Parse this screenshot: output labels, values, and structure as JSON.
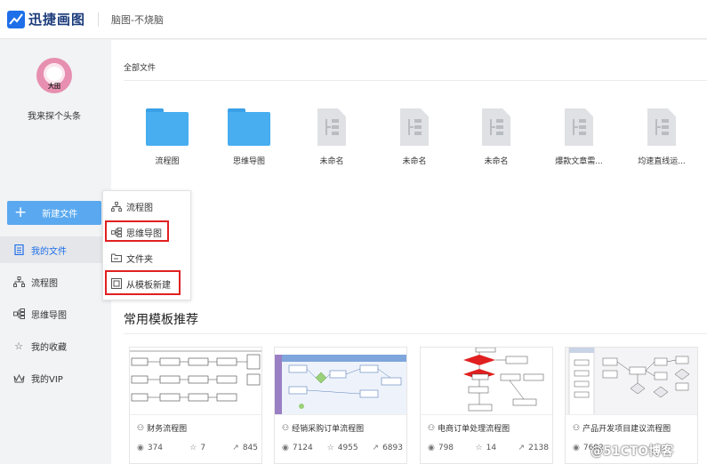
{
  "app": {
    "title": "迅捷画图",
    "document": "脑图-不烧脑"
  },
  "user": {
    "name": "我来探个头条",
    "avatar_tag": "大田"
  },
  "sidebar": {
    "new_button": "新建文件",
    "items": [
      {
        "label": "我的文件",
        "icon": "file-icon",
        "active": true
      },
      {
        "label": "流程图",
        "icon": "flowchart-icon"
      },
      {
        "label": "思维导图",
        "icon": "mindmap-icon"
      },
      {
        "label": "我的收藏",
        "icon": "star-icon"
      },
      {
        "label": "我的VIP",
        "icon": "crown-icon"
      }
    ]
  },
  "files": {
    "section_title": "全部文件",
    "items": [
      {
        "name": "流程图",
        "type": "folder"
      },
      {
        "name": "思维导图",
        "type": "folder"
      },
      {
        "name": "未命名",
        "type": "document"
      },
      {
        "name": "未命名",
        "type": "document"
      },
      {
        "name": "未命名",
        "type": "document"
      },
      {
        "name": "爆款文章需...",
        "type": "document"
      },
      {
        "name": "均速直线运...",
        "type": "document"
      }
    ]
  },
  "new_menu": {
    "items": [
      {
        "label": "流程图",
        "icon": "flowchart-icon"
      },
      {
        "label": "思维导图",
        "icon": "mindmap-icon"
      },
      {
        "label": "文件夹",
        "icon": "folder-icon"
      },
      {
        "label": "从模板新建",
        "icon": "template-icon"
      }
    ],
    "highlight_color": "#e02020"
  },
  "templates": {
    "section_title": "常用模板推荐",
    "items": [
      {
        "name": "财务流程图",
        "views": "374",
        "likes": "7",
        "shares": "845"
      },
      {
        "name": "经销采购订单流程图",
        "views": "7124",
        "likes": "4955",
        "shares": "6893"
      },
      {
        "name": "电商订单处理流程图",
        "views": "798",
        "likes": "14",
        "shares": "2138"
      },
      {
        "name": "产品开发项目建议流程图",
        "views": "7602",
        "likes": "",
        "shares": ""
      }
    ]
  },
  "watermark": "@51CTO博客",
  "colors": {
    "accent": "#1e6fe8",
    "button": "#5aa9f0",
    "folder": "#48aef0"
  }
}
